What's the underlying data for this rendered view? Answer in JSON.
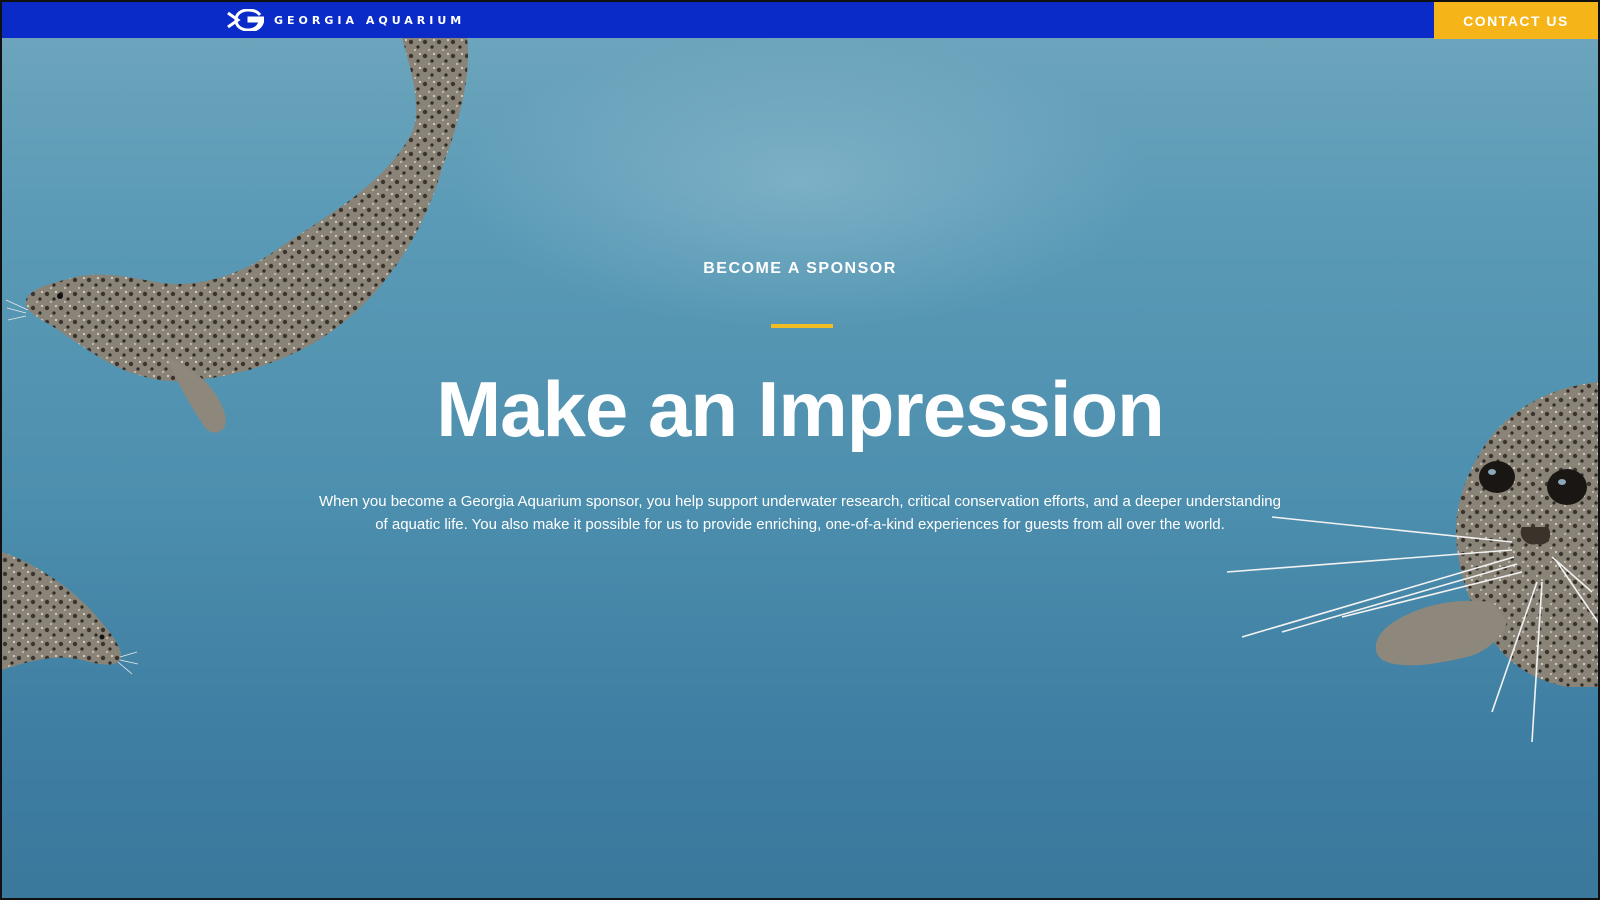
{
  "header": {
    "brand_name": "GEORGIA AQUARIUM",
    "logo_icon": "georgia-aquarium-g-logo",
    "contact_label": "CONTACT US",
    "bar_color": "#0a2bc8",
    "contact_color": "#f5b418"
  },
  "hero": {
    "eyebrow": "BECOME A SPONSOR",
    "headline": "Make an Impression",
    "body": "When you become a Georgia Aquarium sponsor, you help support underwater research, critical conservation efforts, and a deeper understanding of aquatic life. You also make it possible for us to provide enriching, one-of-a-kind experiences for guests from all over the world.",
    "accent_color": "#f1bd22",
    "background_color": "#4d8fae"
  }
}
